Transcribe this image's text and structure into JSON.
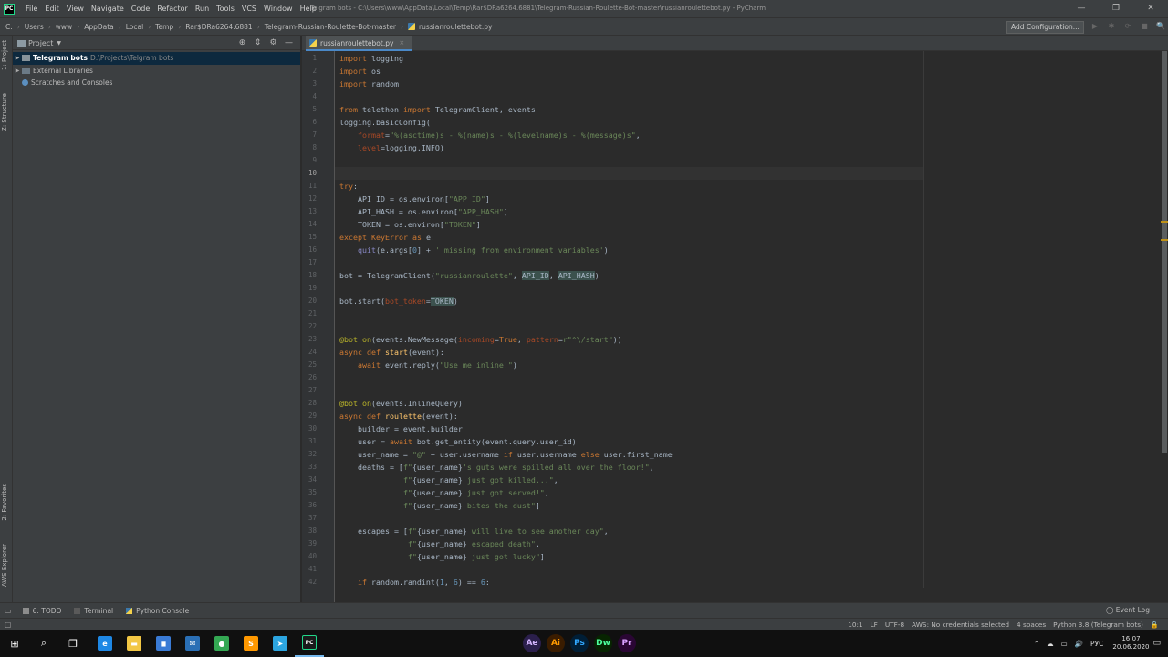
{
  "app": {
    "logo": "PC",
    "window_title": "Telgram bots - C:\\Users\\www\\AppData\\Local\\Temp\\Rar$DRa6264.6881\\Telegram-Russian-Roulette-Bot-master\\russianroulettebot.py - PyCharm"
  },
  "menu": [
    "File",
    "Edit",
    "View",
    "Navigate",
    "Code",
    "Refactor",
    "Run",
    "Tools",
    "VCS",
    "Window",
    "Help"
  ],
  "window_controls": [
    "—",
    "❐",
    "✕"
  ],
  "breadcrumbs": [
    "C:",
    "Users",
    "www",
    "AppData",
    "Local",
    "Temp",
    "Rar$DRa6264.6881",
    "Telegram-Russian-Roulette-Bot-master",
    "russianroulettebot.py"
  ],
  "toolbar": {
    "config_label": "Add Configuration...",
    "run_icons": [
      "▶",
      "✱",
      "⟳",
      "■",
      "🔍"
    ]
  },
  "left_stripe": {
    "project_tab": "1: Project",
    "structure_tab": "Z: Structure",
    "favorites_tab": "2: Favorites",
    "aws_tab": "AWS Explorer"
  },
  "project_panel": {
    "title": "Project",
    "tools": [
      "⊕",
      "⇕",
      "⚙",
      "—"
    ],
    "tree": [
      {
        "label": "Telegram bots",
        "path": "D:\\Projects\\Telgram bots",
        "selected": true
      },
      {
        "label": "External Libraries",
        "path": "",
        "selected": false
      },
      {
        "label": "Scratches and Consoles",
        "path": "",
        "selected": false
      }
    ]
  },
  "editor": {
    "tab_label": "russianroulettebot.py",
    "tab_close": "×",
    "current_line": 10,
    "scroll_position": 0
  },
  "code_lines": [
    "import logging",
    "import os",
    "import random",
    "",
    "from telethon import TelegramClient, events",
    "logging.basicConfig(",
    "    format=\"%(asctime)s - %(name)s - %(levelname)s - %(message)s\",",
    "    level=logging.INFO)",
    "",
    "",
    "try:",
    "    API_ID = os.environ[\"APP_ID\"]",
    "    API_HASH = os.environ[\"APP_HASH\"]",
    "    TOKEN = os.environ[\"TOKEN\"]",
    "except KeyError as e:",
    "    quit(e.args[0] + ' missing from environment variables')",
    "",
    "bot = TelegramClient(\"russianroulette\", API_ID, API_HASH)",
    "",
    "bot.start(bot_token=TOKEN)",
    "",
    "",
    "@bot.on(events.NewMessage(incoming=True, pattern=r\"^\\/start\"))",
    "async def start(event):",
    "    await event.reply(\"Use me inline!\")",
    "",
    "",
    "@bot.on(events.InlineQuery)",
    "async def roulette(event):",
    "    builder = event.builder",
    "    user = await bot.get_entity(event.query.user_id)",
    "    user_name = \"@\" + user.username if user.username else user.first_name",
    "    deaths = [f\"{user_name}'s guts were spilled all over the floor!\",",
    "              f\"{user_name} just got killed...\",",
    "              f\"{user_name} just got served!\",",
    "              f\"{user_name} bites the dust\"]",
    "",
    "    escapes = [f\"{user_name} will live to see another day\",",
    "               f\"{user_name} escaped death\",",
    "               f\"{user_name} just got lucky\"]",
    "",
    "    if random.randint(1, 6) == 6:"
  ],
  "bottom_tools": [
    {
      "label": "6: TODO",
      "icon": "todo-icon"
    },
    {
      "label": "Terminal",
      "icon": "terminal-icon"
    },
    {
      "label": "Python Console",
      "icon": "python-console-icon"
    }
  ],
  "event_log": "Event Log",
  "status": {
    "position": "10:1",
    "line_sep": "LF",
    "encoding": "UTF-8",
    "aws": "AWS: No credentials selected",
    "indent": "4 spaces",
    "interpreter": "Python 3.8 (Telegram bots)"
  },
  "taskbar": {
    "start": "⊞",
    "search": "⌕",
    "taskview": "❐",
    "apps": [
      {
        "name": "edge",
        "glyph": "e",
        "color": "#1e88e5"
      },
      {
        "name": "explorer",
        "glyph": "▬",
        "color": "#f2c744"
      },
      {
        "name": "store",
        "glyph": "◼",
        "color": "#3a7bd5"
      },
      {
        "name": "mail",
        "glyph": "✉",
        "color": "#2a6fb5"
      },
      {
        "name": "chrome",
        "glyph": "●",
        "color": "#34a853"
      },
      {
        "name": "sublime",
        "glyph": "S",
        "color": "#ff9800"
      },
      {
        "name": "telegram",
        "glyph": "➤",
        "color": "#2ca5e0"
      },
      {
        "name": "pycharm",
        "glyph": "PC",
        "color": "#1a1a1a"
      }
    ],
    "adobe": [
      {
        "name": "after-effects",
        "glyph": "Ae",
        "color": "#2b1f4c",
        "fg": "#d5b6ff"
      },
      {
        "name": "illustrator",
        "glyph": "Ai",
        "color": "#3a1c00",
        "fg": "#ff9a00"
      },
      {
        "name": "photoshop",
        "glyph": "Ps",
        "color": "#001e36",
        "fg": "#31a8ff"
      },
      {
        "name": "dreamweaver",
        "glyph": "Dw",
        "color": "#072401",
        "fg": "#4cff9d"
      },
      {
        "name": "premiere",
        "glyph": "Pr",
        "color": "#2a0634",
        "fg": "#d8a0ff"
      }
    ],
    "tray_icons": [
      "⌃",
      "☁",
      "▭",
      "🔊"
    ],
    "lang": "РУС",
    "time": "16:07",
    "date": "20.06.2020"
  }
}
